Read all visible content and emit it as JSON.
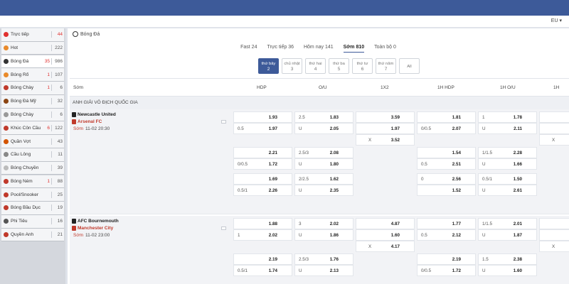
{
  "header": {
    "region_label": "EU"
  },
  "sidebar": {
    "items": [
      {
        "label": "Trực tiếp",
        "live": "",
        "count": "44",
        "count_red": true,
        "color": "#e0302f"
      },
      {
        "label": "Hot",
        "live": "",
        "count": "222",
        "count_red": false,
        "color": "#e98a2b"
      },
      {
        "label": "Bóng Đá",
        "live": "35",
        "count": "986",
        "count_red": false,
        "color": "#333333",
        "active": true
      },
      {
        "label": "Bóng Rổ",
        "live": "1",
        "count": "107",
        "count_red": false,
        "color": "#e98a2b"
      },
      {
        "label": "Bóng Chày",
        "live": "1",
        "count": "6",
        "count_red": false,
        "color": "#c0392b"
      },
      {
        "label": "Bóng Đá Mỹ",
        "live": "",
        "count": "32",
        "count_red": false,
        "color": "#8b4513"
      },
      {
        "label": "Bóng Chày",
        "live": "",
        "count": "6",
        "count_red": false,
        "color": "#999999"
      },
      {
        "label": "Khúc Côn Cầu",
        "live": "6",
        "count": "122",
        "count_red": false,
        "color": "#c0392b"
      },
      {
        "label": "Quần Vợt",
        "live": "",
        "count": "43",
        "count_red": false,
        "color": "#d35400"
      },
      {
        "label": "Cầu Lông",
        "live": "",
        "count": "11",
        "count_red": false,
        "color": "#888888"
      },
      {
        "label": "Bóng Chuyền",
        "live": "",
        "count": "39",
        "count_red": false,
        "color": "#bbbbbb"
      },
      {
        "label": "Bóng Ném",
        "live": "1",
        "count": "88",
        "count_red": false,
        "color": "#c0392b"
      },
      {
        "label": "Pool/Snooker",
        "live": "",
        "count": "25",
        "count_red": false,
        "color": "#c0392b"
      },
      {
        "label": "Bóng Bầu Dục",
        "live": "",
        "count": "19",
        "count_red": false,
        "color": "#c0392b"
      },
      {
        "label": "Phi Tiêu",
        "live": "",
        "count": "16",
        "count_red": false,
        "color": "#555555"
      },
      {
        "label": "Quyền Anh",
        "live": "",
        "count": "21",
        "count_red": false,
        "color": "#c0392b"
      }
    ]
  },
  "main": {
    "title": "Bóng Đá",
    "tabs": [
      {
        "label": "Fast 24"
      },
      {
        "label": "Trực tiếp 36"
      },
      {
        "label": "Hôm nay 141"
      },
      {
        "label": "Sớm 810",
        "active": true
      },
      {
        "label": "Toàn bộ 0"
      }
    ],
    "days": [
      {
        "name": "thứ bảy",
        "num": "2",
        "active": true
      },
      {
        "name": "chủ nhật",
        "num": "3"
      },
      {
        "name": "thứ hai",
        "num": "4"
      },
      {
        "name": "thứ ba",
        "num": "5"
      },
      {
        "name": "thứ tư",
        "num": "6"
      },
      {
        "name": "thứ năm",
        "num": "7"
      },
      {
        "name": "All",
        "num": ""
      }
    ]
  },
  "table": {
    "headers": {
      "col0": "Sớm",
      "hdp": "HDP",
      "ou": "O/U",
      "x12": "1X2",
      "h1hdp": "1H HDP",
      "h1ou": "1H O/U",
      "h1x2": "1H"
    },
    "league": "ANH GIẢI VÔ ĐỊCH QUỐC GIA",
    "matches": [
      {
        "home": "Newcastle United",
        "away": "Arsenal FC",
        "stage": "Sớm",
        "datetime": "11-02 20:30",
        "lines": [
          {
            "hdp_h": "",
            "hdp_a": "0.5",
            "hdp_o1": "1.93",
            "hdp_o2": "1.97",
            "ou_l": "2.5",
            "ou_u": "U",
            "ou_o1": "1.83",
            "ou_o2": "2.05",
            "x12_1": "3.59",
            "x12_2": "1.97",
            "x12_x": "X",
            "x12_3": "3.52",
            "h1_h": "",
            "h1_a": "0/0.5",
            "h1_o1": "1.81",
            "h1_o2": "2.07",
            "h1ou_l": "1",
            "h1ou_u": "U",
            "h1ou_o1": "1.78",
            "h1ou_o2": "2.11",
            "h1x_x": "X"
          },
          {
            "hdp_h": "",
            "hdp_a": "0/0.5",
            "hdp_o1": "2.21",
            "hdp_o2": "1.72",
            "ou_l": "2.5/3",
            "ou_u": "U",
            "ou_o1": "2.08",
            "ou_o2": "1.80",
            "h1_h": "",
            "h1_a": "0.5",
            "h1_o1": "1.54",
            "h1_o2": "2.51",
            "h1ou_l": "1/1.5",
            "h1ou_u": "U",
            "h1ou_o1": "2.28",
            "h1ou_o2": "1.66"
          },
          {
            "hdp_h": "",
            "hdp_a": "0.5/1",
            "hdp_o1": "1.69",
            "hdp_o2": "2.26",
            "ou_l": "2/2.5",
            "ou_u": "U",
            "ou_o1": "1.62",
            "ou_o2": "2.35",
            "h1_h": "0",
            "h1_a": "",
            "h1_o1": "2.56",
            "h1_o2": "1.52",
            "h1ou_l": "0.5/1",
            "h1ou_u": "U",
            "h1ou_o1": "1.50",
            "h1ou_o2": "2.61"
          }
        ]
      },
      {
        "home": "AFC Bournemouth",
        "away": "Manchester City",
        "stage": "Sớm",
        "datetime": "11-02 23:00",
        "lines": [
          {
            "hdp_h": "",
            "hdp_a": "1",
            "hdp_o1": "1.88",
            "hdp_o2": "2.02",
            "ou_l": "3",
            "ou_u": "U",
            "ou_o1": "2.02",
            "ou_o2": "1.86",
            "x12_1": "4.87",
            "x12_2": "1.60",
            "x12_x": "X",
            "x12_3": "4.17",
            "h1_h": "",
            "h1_a": "0.5",
            "h1_o1": "1.77",
            "h1_o2": "2.12",
            "h1ou_l": "1/1.5",
            "h1ou_u": "U",
            "h1ou_o1": "2.01",
            "h1ou_o2": "1.87",
            "h1x_x": "X"
          },
          {
            "hdp_h": "",
            "hdp_a": "0.5/1",
            "hdp_o1": "2.19",
            "hdp_o2": "1.74",
            "ou_l": "2.5/3",
            "ou_u": "U",
            "ou_o1": "1.76",
            "ou_o2": "2.13",
            "h1_h": "",
            "h1_a": "0/0.5",
            "h1_o1": "2.19",
            "h1_o2": "1.72",
            "h1ou_l": "1.5",
            "h1ou_u": "U",
            "h1ou_o1": "2.38",
            "h1ou_o2": "1.60"
          }
        ]
      }
    ]
  }
}
